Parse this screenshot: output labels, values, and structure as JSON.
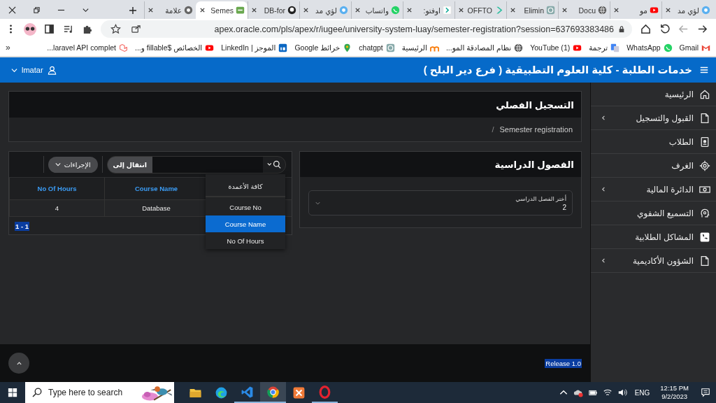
{
  "browser": {
    "tabs": [
      {
        "title": "لؤي مد",
        "kind": "circle",
        "selected": false
      },
      {
        "title": "مو",
        "kind": "youtube",
        "selected": false
      },
      {
        "title": "Docu",
        "kind": "globe",
        "selected": false
      },
      {
        "title": "Elimin",
        "kind": "openai",
        "selected": false
      },
      {
        "title": "OFFTO",
        "kind": "chevron",
        "selected": false
      },
      {
        "title": "اوفتو:",
        "kind": "chevron-box",
        "selected": false
      },
      {
        "title": "واتساب",
        "kind": "whatsapp",
        "selected": false
      },
      {
        "title": "لؤي مد",
        "kind": "circle",
        "selected": false
      },
      {
        "title": "DB-for",
        "kind": "github",
        "selected": false
      },
      {
        "title": "Semes",
        "kind": "apex",
        "selected": true
      },
      {
        "title": "علامة",
        "kind": "chrome",
        "selected": false
      }
    ],
    "address": "apex.oracle.com/pls/apex/r/iugee/university-system-luay/semester-registration?session=637693383486",
    "bookmarks": [
      {
        "label": "Gmail",
        "kind": "gmail"
      },
      {
        "label": "WhatsApp",
        "kind": "whatsapp"
      },
      {
        "label": "ترجمة",
        "kind": "translate"
      },
      {
        "label": "(1) YouTube",
        "kind": "youtube"
      },
      {
        "label": "نظام المصادقة المو...",
        "kind": "globe"
      },
      {
        "label": "الرئيسية",
        "kind": "moodle"
      },
      {
        "label": "chatgpt",
        "kind": "openai"
      },
      {
        "label": "خرائط Google",
        "kind": "maps"
      },
      {
        "label": "الموجز | LinkedIn",
        "kind": "linkedin"
      },
      {
        "label": "الخصائص $fillable و...",
        "kind": "youtube"
      },
      {
        "label": "laravel API complet...",
        "kind": "laravel"
      }
    ],
    "more": "«"
  },
  "app": {
    "title": "خدمات الطلبة - كلية العلوم التطبيقية ( فرع دير البلح )",
    "user": "lmatar"
  },
  "sidebar": {
    "items": [
      {
        "label": "الرئيسية",
        "kind": "home",
        "expandable": false
      },
      {
        "label": "القبول والتسجيل",
        "kind": "file",
        "expandable": true
      },
      {
        "label": "الطلاب",
        "kind": "contact",
        "expandable": false
      },
      {
        "label": "الغرف",
        "kind": "target",
        "expandable": false
      },
      {
        "label": "الدائرة المالية",
        "kind": "money",
        "expandable": true
      },
      {
        "label": "التسميع الشفوي",
        "kind": "head",
        "expandable": false
      },
      {
        "label": "المشاكل الطلابية",
        "kind": "phone",
        "expandable": false
      },
      {
        "label": "الشؤون الأكاديمية",
        "kind": "file",
        "expandable": true
      }
    ]
  },
  "page": {
    "title": "التسجيل الفصلي",
    "breadcrumb": "Semester registration",
    "breadcrumb_separator": "/"
  },
  "semesters": {
    "title": "الفصول الدراسية",
    "select": {
      "label": "أختر الفصل الدراسي",
      "value": "2"
    }
  },
  "report": {
    "go_button": "انتقال إلى",
    "actions_button": "الإجراءات",
    "columns": [
      "Course Name",
      "No Of Hours"
    ],
    "rows": [
      [
        "Database",
        "4"
      ]
    ],
    "pagination": "1 - 1",
    "column_menu": [
      {
        "label": "كافة الأعمدة",
        "selected": false
      },
      {
        "label": "Course No",
        "selected": false
      },
      {
        "label": "Course Name",
        "selected": true
      },
      {
        "label": "No Of Hours",
        "selected": false
      }
    ]
  },
  "footer": {
    "release": "Release 1.0"
  },
  "taskbar": {
    "search_placeholder": "Type here to search",
    "apps": [
      {
        "kind": "explorer",
        "open": false,
        "active": false
      },
      {
        "kind": "edge",
        "open": false,
        "active": false
      },
      {
        "kind": "vscode",
        "open": true,
        "active": false
      },
      {
        "kind": "chrome",
        "open": true,
        "active": true
      },
      {
        "kind": "xampp",
        "open": false,
        "active": false
      },
      {
        "kind": "opera",
        "open": true,
        "active": false
      }
    ],
    "language": "ENG",
    "time": "12:15 PM",
    "date": "9/2/2023"
  }
}
